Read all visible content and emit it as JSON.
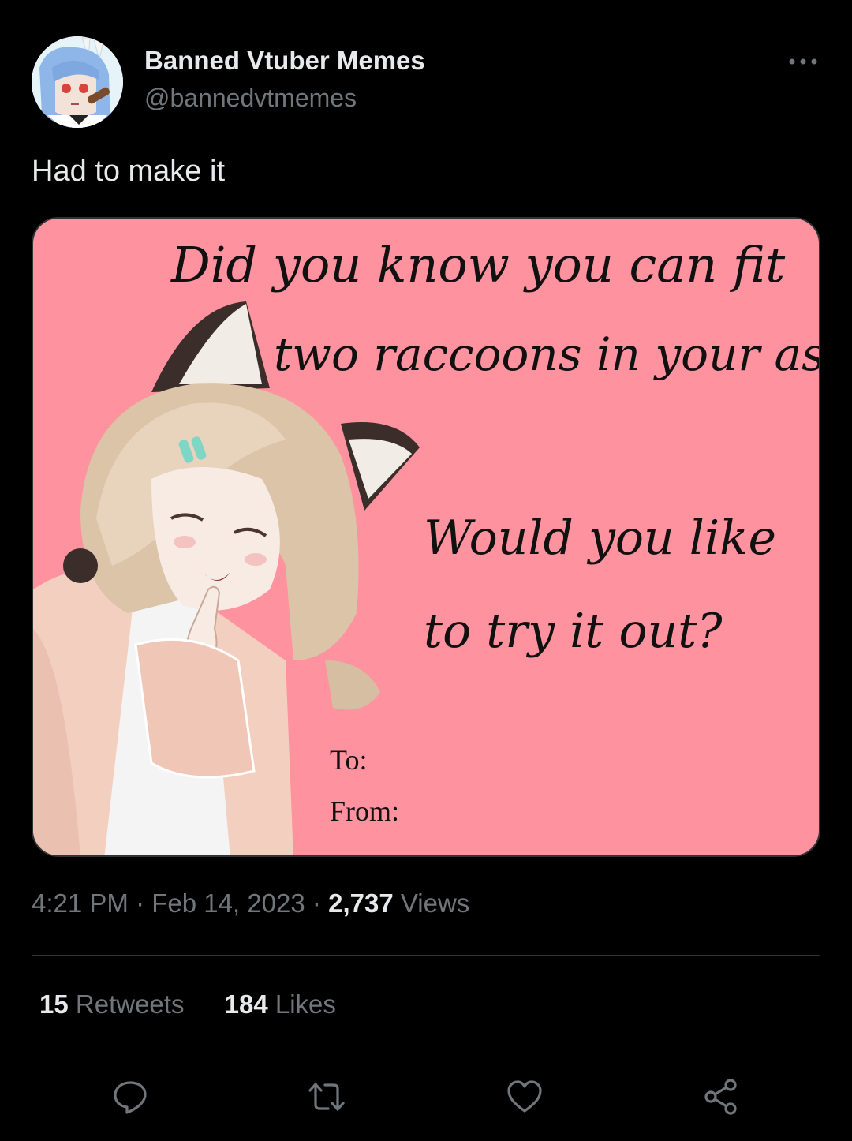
{
  "author": {
    "display_name": "Banned Vtuber Memes",
    "handle": "@bannedvtmemes",
    "avatar_icon": "avatar-icon"
  },
  "tweet": {
    "text": "Had to make it",
    "time": "4:21 PM",
    "date": "Feb 14, 2023",
    "views_count": "2,737",
    "views_label": "Views"
  },
  "card": {
    "line1": "Did you know you can fit",
    "line2": "two raccoons in your ass",
    "line3": "Would you like",
    "line4": "to try it out?",
    "to_label": "To:",
    "from_label": "From:",
    "background_color": "#ff929f"
  },
  "stats": {
    "retweets_count": "15",
    "retweets_label": "Retweets",
    "likes_count": "184",
    "likes_label": "Likes"
  },
  "actions": [
    "reply-icon",
    "retweet-icon",
    "like-icon",
    "share-icon"
  ],
  "colors": {
    "background": "#000000",
    "primary_text": "#e7e9ea",
    "secondary_text": "#71767b",
    "divider": "#2f3336"
  }
}
